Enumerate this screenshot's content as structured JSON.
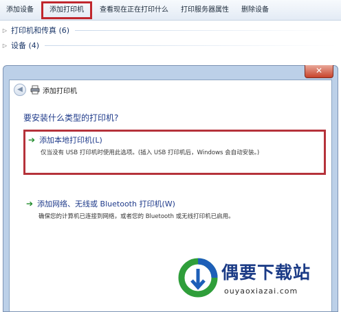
{
  "toolbar": {
    "items": [
      "添加设备",
      "添加打印机",
      "查看现在正在打印什么",
      "打印服务器属性",
      "删除设备"
    ]
  },
  "groups": [
    {
      "label": "打印机和传真 (6)"
    },
    {
      "label": "设备 (4)"
    }
  ],
  "dialog": {
    "title": "添加打印机",
    "close_symbol": "✕",
    "question": "要安装什么类型的打印机?",
    "options": [
      {
        "title": "添加本地打印机(L)",
        "description": "仅当没有 USB 打印机时使用此选项。(插入 USB 打印机后，Windows 会自动安装。)",
        "selected": true
      },
      {
        "title": "添加网络、无线或 Bluetooth 打印机(W)",
        "description": "确保您的计算机已连接到网络，或者您的 Bluetooth 或无线打印机已启用。",
        "selected": false
      }
    ]
  },
  "watermark": {
    "name": "偶要下载站",
    "url": "ouyaoxiazai.com"
  },
  "colors": {
    "highlight_border": "#c0272d",
    "link_blue": "#1e3a8a",
    "arrow_green": "#1f8a2a"
  }
}
